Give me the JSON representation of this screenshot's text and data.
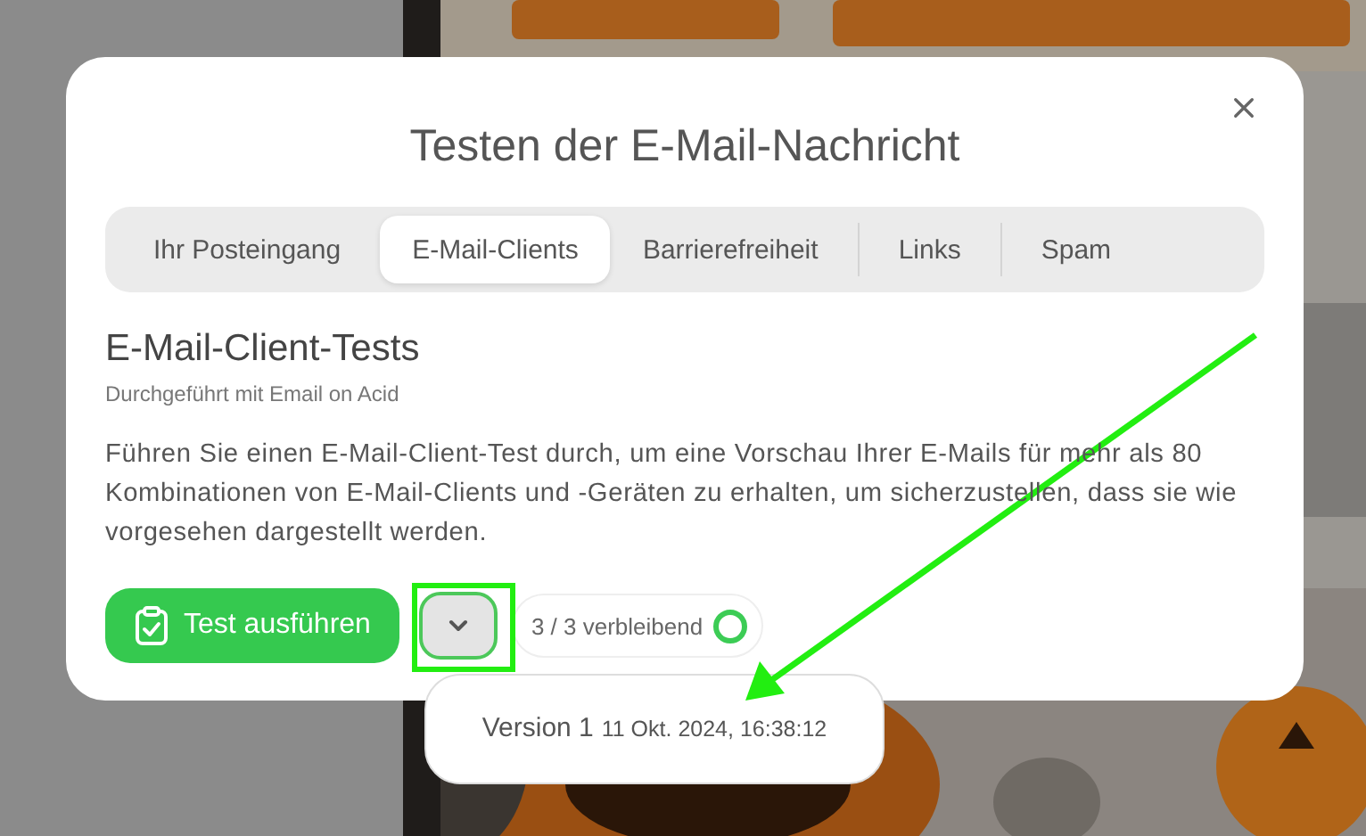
{
  "dialog": {
    "title": "Testen der E-Mail-Nachricht"
  },
  "tabs": [
    {
      "label": "Ihr Posteingang",
      "selected": false
    },
    {
      "label": "E-Mail-Clients",
      "selected": true
    },
    {
      "label": "Barrierefreiheit",
      "selected": false
    },
    {
      "label": "Links",
      "selected": false
    },
    {
      "label": "Spam",
      "selected": false
    }
  ],
  "section": {
    "heading": "E-Mail-Client-Tests",
    "subtitle": "Durchgeführt mit Email on Acid",
    "description": "Führen Sie einen E-Mail-Client-Test durch, um eine Vorschau Ihrer E-Mails für mehr als 80 Kombinationen von E-Mail-Clients und -Geräten zu erhalten, um sicherzustellen, dass sie wie vorgesehen dargestellt werden."
  },
  "run_button": {
    "label": "Test ausführen"
  },
  "remaining": {
    "text": "3 / 3 verbleibend"
  },
  "versions_menu": {
    "expanded": true,
    "items": [
      {
        "label": "Version 1",
        "date": "11 Okt. 2024, 16:38:12"
      }
    ]
  }
}
